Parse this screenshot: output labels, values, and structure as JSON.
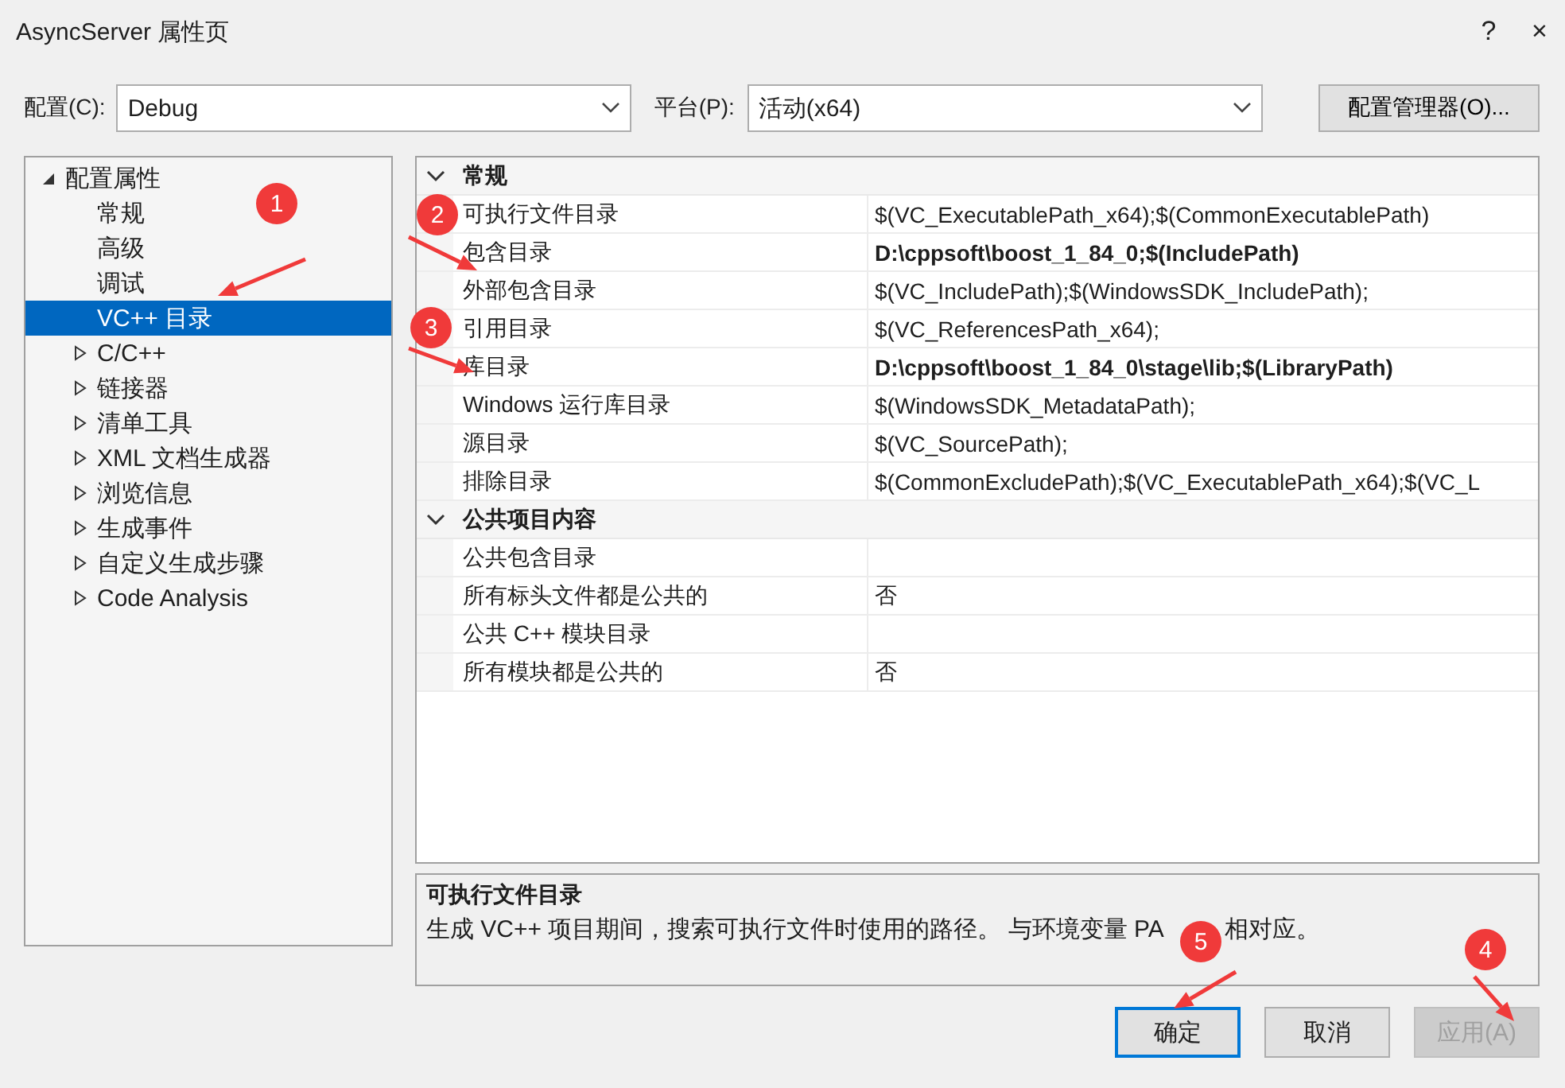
{
  "window": {
    "title": "AsyncServer 属性页",
    "help": "?",
    "close": "×"
  },
  "toolbar": {
    "config_label": "配置(C):",
    "config_value": "Debug",
    "platform_label": "平台(P):",
    "platform_value": "活动(x64)",
    "manager_button": "配置管理器(O)..."
  },
  "tree": [
    {
      "label": "配置属性",
      "kind": "group",
      "expanded": true,
      "selected": false,
      "children": [
        {
          "label": "常规",
          "kind": "page",
          "selected": false
        },
        {
          "label": "高级",
          "kind": "page",
          "selected": false
        },
        {
          "label": "调试",
          "kind": "page",
          "selected": false
        },
        {
          "label": "VC++ 目录",
          "kind": "page",
          "selected": true
        },
        {
          "label": "C/C++",
          "kind": "group",
          "expanded": false,
          "selected": false
        },
        {
          "label": "链接器",
          "kind": "group",
          "expanded": false,
          "selected": false
        },
        {
          "label": "清单工具",
          "kind": "group",
          "expanded": false,
          "selected": false
        },
        {
          "label": "XML 文档生成器",
          "kind": "group",
          "expanded": false,
          "selected": false
        },
        {
          "label": "浏览信息",
          "kind": "group",
          "expanded": false,
          "selected": false
        },
        {
          "label": "生成事件",
          "kind": "group",
          "expanded": false,
          "selected": false
        },
        {
          "label": "自定义生成步骤",
          "kind": "group",
          "expanded": false,
          "selected": false
        },
        {
          "label": "Code Analysis",
          "kind": "group",
          "expanded": false,
          "selected": false
        }
      ]
    }
  ],
  "grid": {
    "categories": [
      {
        "name": "常规",
        "expanded": true,
        "rows": [
          {
            "name": "可执行文件目录",
            "value": "$(VC_ExecutablePath_x64);$(CommonExecutablePath)",
            "modified": false
          },
          {
            "name": "包含目录",
            "value": "D:\\cppsoft\\boost_1_84_0;$(IncludePath)",
            "modified": true
          },
          {
            "name": "外部包含目录",
            "value": "$(VC_IncludePath);$(WindowsSDK_IncludePath);",
            "modified": false
          },
          {
            "name": "引用目录",
            "value": "$(VC_ReferencesPath_x64);",
            "modified": false
          },
          {
            "name": "库目录",
            "value": "D:\\cppsoft\\boost_1_84_0\\stage\\lib;$(LibraryPath)",
            "modified": true
          },
          {
            "name": "Windows 运行库目录",
            "value": "$(WindowsSDK_MetadataPath);",
            "modified": false
          },
          {
            "name": "源目录",
            "value": "$(VC_SourcePath);",
            "modified": false
          },
          {
            "name": "排除目录",
            "value": "$(CommonExcludePath);$(VC_ExecutablePath_x64);$(VC_L",
            "modified": false
          }
        ]
      },
      {
        "name": "公共项目内容",
        "expanded": true,
        "rows": [
          {
            "name": "公共包含目录",
            "modified": false
          },
          {
            "name": "所有标头文件都是公共的",
            "value": "否",
            "modified": false
          },
          {
            "name": "公共 C++ 模块目录",
            "modified": false
          },
          {
            "name": "所有模块都是公共的",
            "value": "否",
            "modified": false
          }
        ]
      }
    ]
  },
  "description": {
    "title": "可执行文件目录",
    "text_parts": [
      "生成 VC++ 项目期间，搜索可执行文件时使用的路径。 与环境变量 PA",
      "相对应。"
    ]
  },
  "buttons": [
    {
      "label": "确定",
      "kind": "default",
      "disabled": false
    },
    {
      "label": "取消",
      "kind": "normal",
      "disabled": false
    },
    {
      "label": "应用(A)",
      "kind": "normal",
      "disabled": true
    }
  ],
  "annotations": [
    {
      "label": "1"
    },
    {
      "label": "2"
    },
    {
      "label": "3"
    },
    {
      "label": "4"
    },
    {
      "label": "5"
    }
  ]
}
